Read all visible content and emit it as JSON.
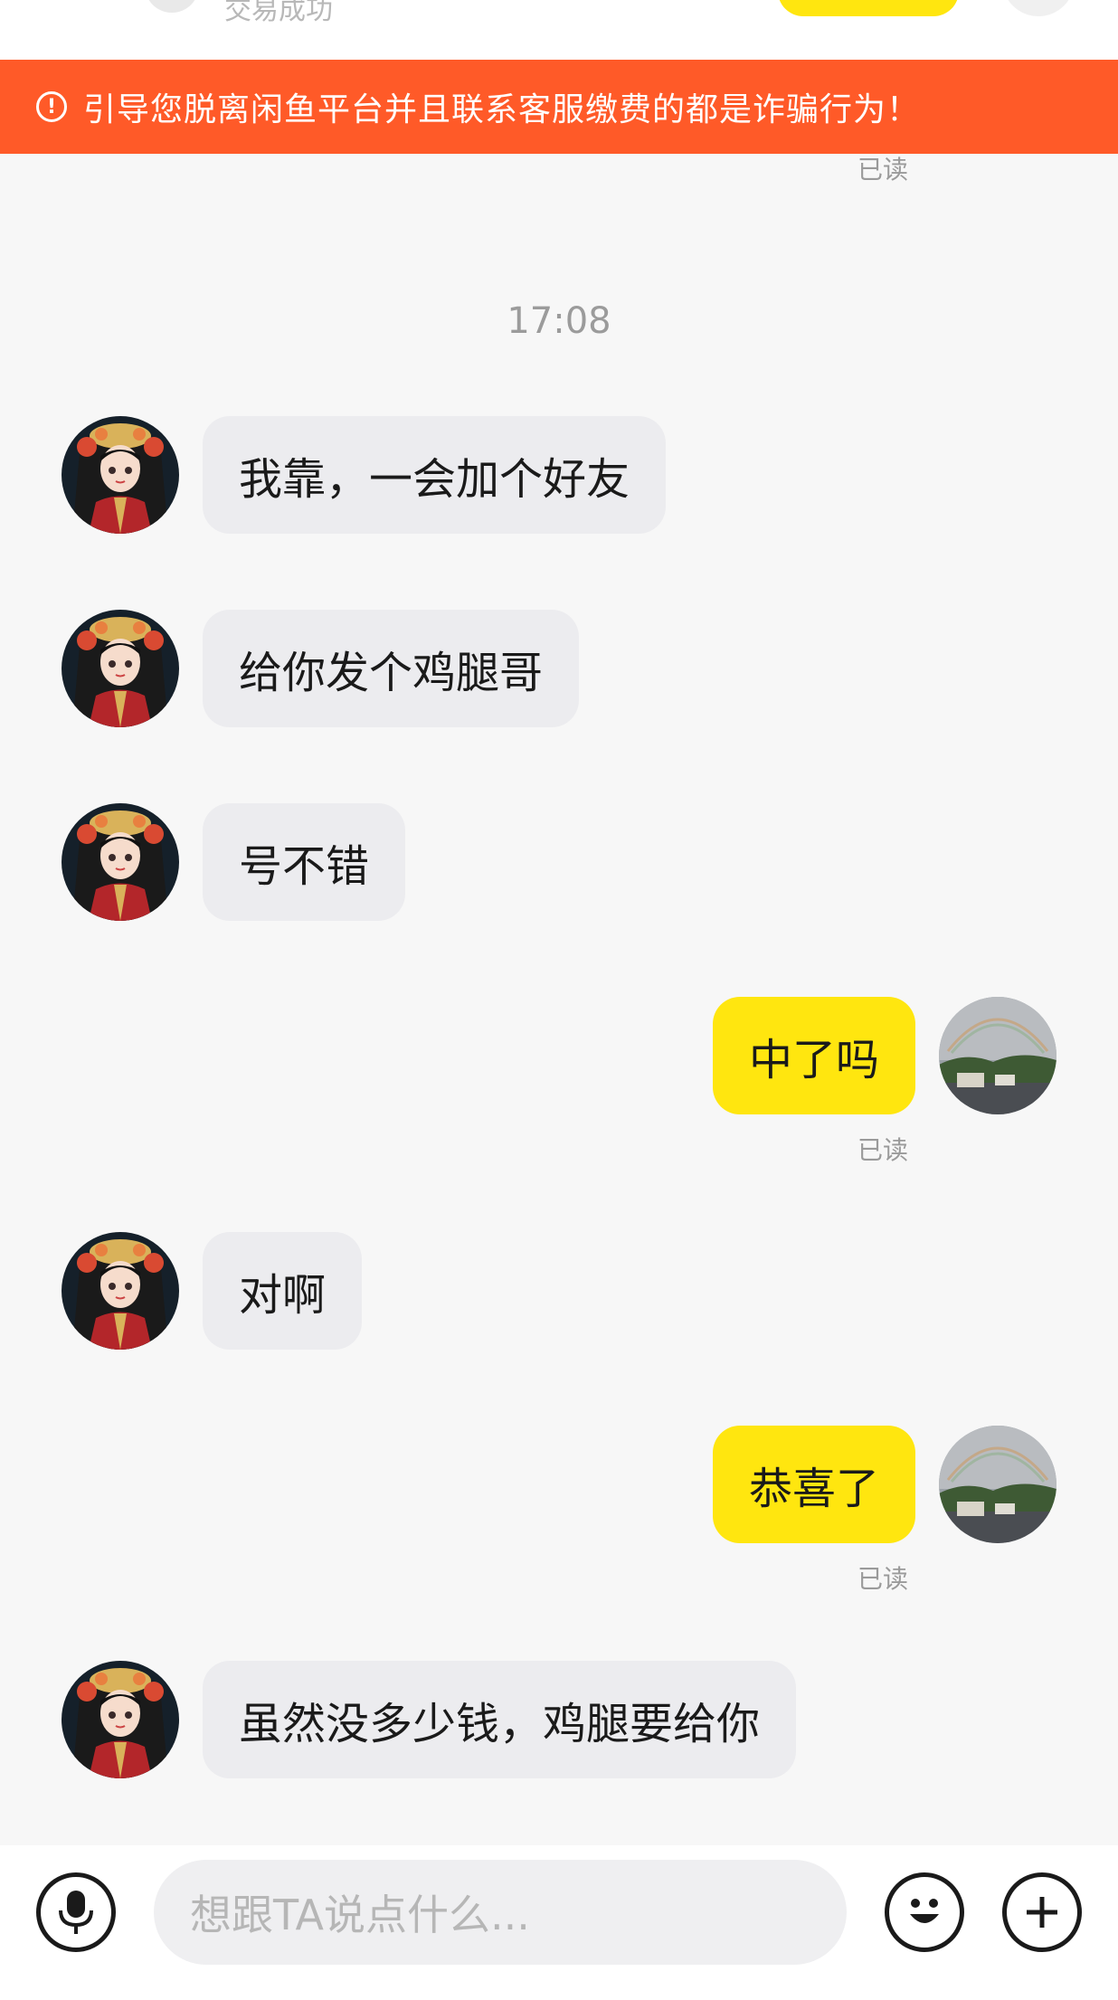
{
  "header": {
    "status_text": "交易成功"
  },
  "warning": {
    "text": "引导您脱离闲鱼平台并且联系客服缴费的都是诈骗行为！",
    "icon": "exclamation-circle-icon"
  },
  "chat": {
    "top_read_label": "已读",
    "timestamp": "17:08",
    "messages": [
      {
        "sender": "other",
        "text": "我靠，一会加个好友"
      },
      {
        "sender": "other",
        "text": "给你发个鸡腿哥"
      },
      {
        "sender": "other",
        "text": "号不错"
      },
      {
        "sender": "self",
        "text": "中了吗",
        "status": "已读"
      },
      {
        "sender": "other",
        "text": "对啊"
      },
      {
        "sender": "self",
        "text": "恭喜了",
        "status": "已读"
      },
      {
        "sender": "other",
        "text": "虽然没多少钱，鸡腿要给你"
      }
    ]
  },
  "composer": {
    "placeholder": "想跟TA说点什么...",
    "voice_icon": "microphone-icon",
    "emoji_icon": "emoji-icon",
    "plus_icon": "plus-icon"
  },
  "colors": {
    "warning_bg": "#ff5a28",
    "outgoing_bubble": "#ffe60f",
    "incoming_bubble": "#ececef"
  }
}
